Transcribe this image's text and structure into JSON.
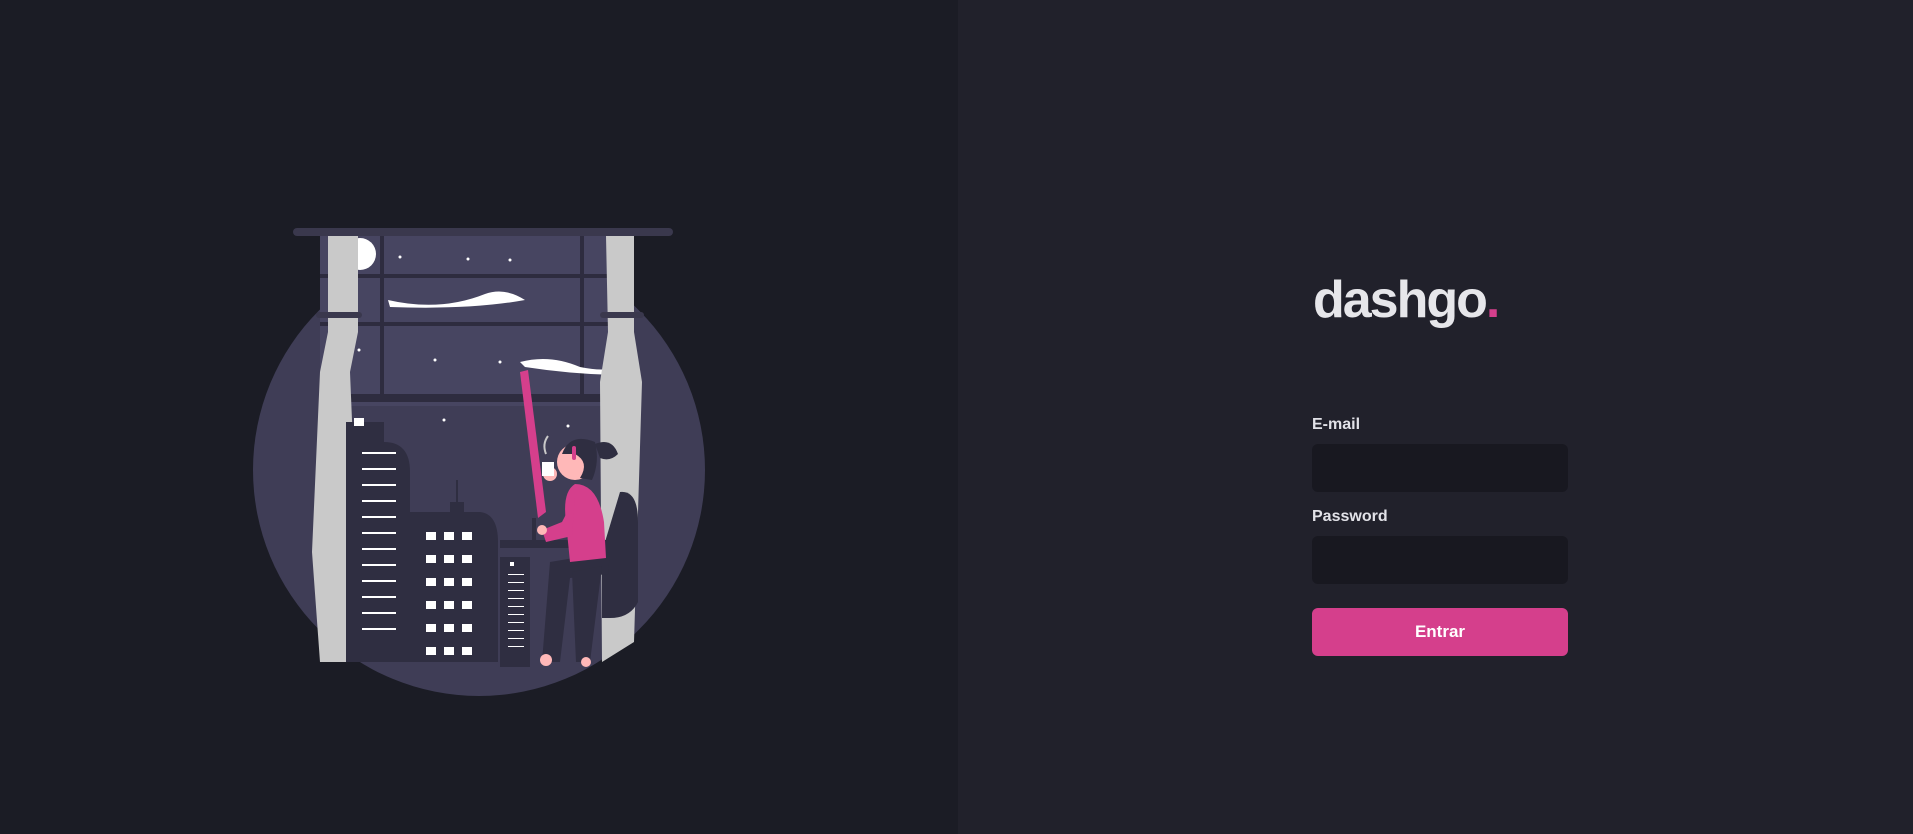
{
  "brand": {
    "name": "dashgo",
    "dot": ".",
    "accent_color": "#d53f8c"
  },
  "illustration": {
    "icon": "woman-coffee-city-window-illustration"
  },
  "form": {
    "email_label": "E-mail",
    "email_value": "",
    "password_label": "Password",
    "password_value": "",
    "submit_label": "Entrar"
  },
  "colors": {
    "left_bg": "#1b1c25",
    "right_bg": "#21212b",
    "input_bg": "#181820",
    "button_bg": "#d53f8c"
  }
}
